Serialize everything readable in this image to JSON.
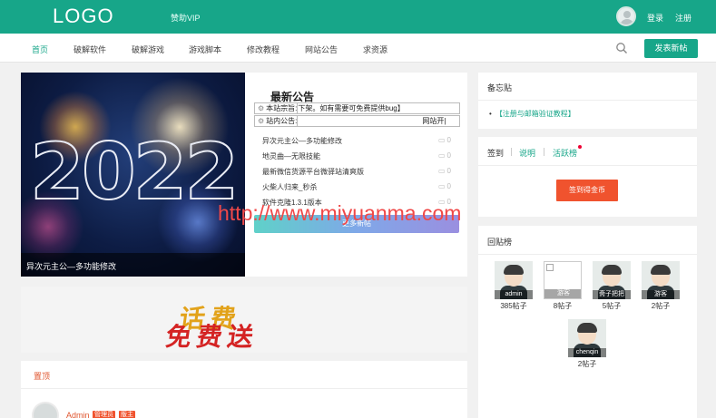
{
  "header": {
    "logo": "LOGO",
    "vip": "赞助VIP",
    "login": "登录",
    "register": "注册"
  },
  "nav": {
    "items": [
      "首页",
      "破解软件",
      "破解游戏",
      "游戏脚本",
      "修改教程",
      "网站公告",
      "求资源"
    ],
    "active_index": 0,
    "post_button": "发表新帖"
  },
  "banner": {
    "year": "2022",
    "caption": "异次元主公—多功能修改"
  },
  "notice": {
    "title": "最新公告",
    "row1_label": "本站宗旨:",
    "row1_text": "下架。如有需要可免费提供bug】",
    "row2_label": "站内公告:",
    "row2_text": "网站开|"
  },
  "news": [
    {
      "title": "异次元主公—多功能修改",
      "comments": "0"
    },
    {
      "title": "地灵曲—无限技能",
      "comments": "0"
    },
    {
      "title": "最新微信货源平台微驿站清爽版",
      "comments": "0"
    },
    {
      "title": "火柴人归来_秒杀",
      "comments": "0"
    },
    {
      "title": "软件克隆1.3.1版本",
      "comments": "0"
    }
  ],
  "more_button": "更多新帖",
  "ad": {
    "line1": "话费",
    "line2": "免费送"
  },
  "sticky": {
    "title": "置顶",
    "author": "Admin",
    "badges": [
      "管理员",
      "版主"
    ]
  },
  "memo": {
    "title": "备忘贴",
    "item": "【注册与邮箱验证教程】"
  },
  "sign": {
    "tabs": [
      "签到",
      "说明",
      "活跃榜"
    ],
    "button": "签到得金币"
  },
  "reply_rank": {
    "title": "回贴榜",
    "users": [
      {
        "name": "admin",
        "count": "385帖子",
        "broken": false
      },
      {
        "name": "游客",
        "count": "8帖子",
        "broken": true
      },
      {
        "name": "斋子把把",
        "count": "5帖子",
        "broken": false
      },
      {
        "name": "游客",
        "count": "2帖子",
        "broken": false
      },
      {
        "name": "chenqin",
        "count": "2帖子",
        "broken": false
      }
    ]
  },
  "watermark": "http://www.miyuanma.com",
  "colors": {
    "primary": "#17a689",
    "accent": "#f0532e",
    "link": "#17a689"
  }
}
